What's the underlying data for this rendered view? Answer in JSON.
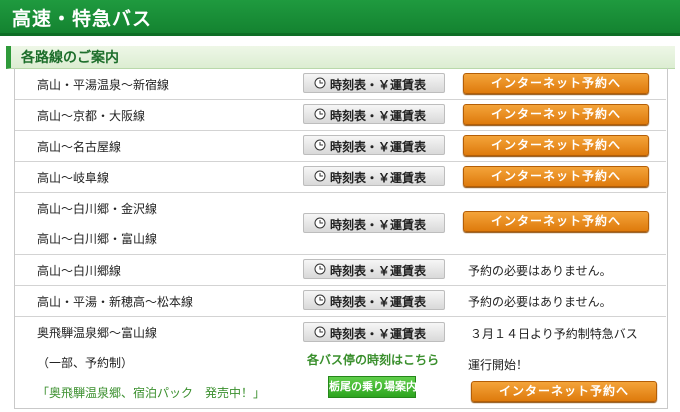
{
  "header": {
    "title": "高速・特急バス"
  },
  "section": {
    "title": "各路線のご案内"
  },
  "timetable_label": "時刻表・￥運賃表",
  "reserve_label": "インターネット予約へ",
  "rows": [
    {
      "routes": [
        "高山・平湯温泉～新宿線"
      ],
      "action": "インターネット予約へ"
    },
    {
      "routes": [
        "高山～京都・大阪線"
      ],
      "action": "インターネット予約へ"
    },
    {
      "routes": [
        "高山～名古屋線"
      ],
      "action": "インターネット予約へ"
    },
    {
      "routes": [
        "高山～岐阜線"
      ],
      "action": "インターネット予約へ"
    },
    {
      "routes": [
        "高山～白川郷・金沢線",
        "高山～白川郷・富山線"
      ],
      "action": "インターネット予約へ"
    },
    {
      "routes": [
        "高山～白川郷線"
      ],
      "note": "予約の必要はありません。"
    },
    {
      "routes": [
        "高山・平湯・新穂高～松本線"
      ],
      "note": "予約の必要はありません。"
    }
  ],
  "last_row": {
    "route": "奥飛騨温泉郷～富山線",
    "sub": "（一部、予約制）",
    "promo": "「奥飛騨温泉郷、宿泊パック　発売中！」",
    "stops_link": "各バス停の時刻はこちら",
    "boarding_button": "栃尾の乗り場案内",
    "note_line1": "３月１４日より予約制特急バス",
    "note_line2": "運行開始！",
    "action": "インターネット予約へ"
  }
}
